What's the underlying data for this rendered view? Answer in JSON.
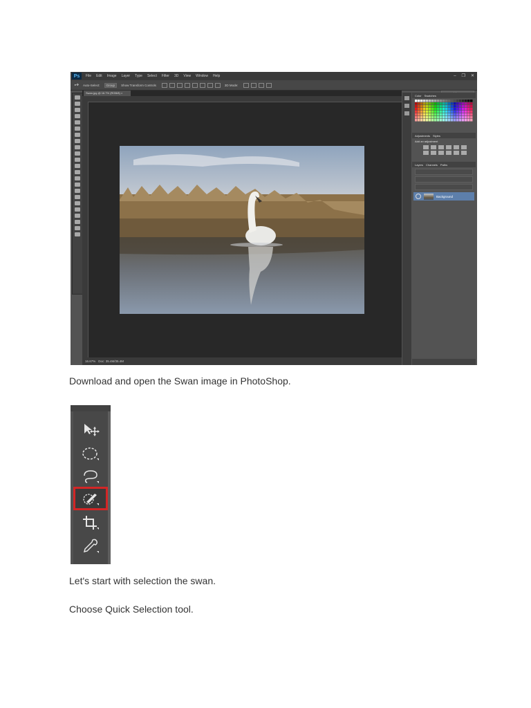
{
  "screenshot": {
    "menu": [
      "File",
      "Edit",
      "Image",
      "Layer",
      "Type",
      "Select",
      "Filter",
      "3D",
      "View",
      "Window",
      "Help"
    ],
    "window_controls": [
      "–",
      "❐",
      "✕"
    ],
    "options_bar": {
      "auto_select": "Auto-Select:",
      "auto_select_value": "Group",
      "show_transform": "Show Transform Controls",
      "mode_3d": "3D Mode:"
    },
    "workspace": "Essentials",
    "document_tab": "Swan.jpg @ 16.7% (RGB/8) ×",
    "status": {
      "zoom": "16.67%",
      "doc": "Doc: 35.4M/35.4M"
    },
    "panels": {
      "color_tabs": [
        "Color",
        "Swatches"
      ],
      "adjust_tabs": [
        "Adjustments",
        "Styles"
      ],
      "adjust_label": "Add an adjustment",
      "layers_tabs": [
        "Layers",
        "Channels",
        "Paths"
      ],
      "layer_name": "Background"
    }
  },
  "captions": {
    "step1": "Download and open the Swan image in PhotoShop.",
    "step2": "Let's start with selection the swan.",
    "step3": "Choose Quick Selection tool."
  },
  "tools": [
    "move-tool",
    "elliptical-marquee-tool",
    "lasso-tool",
    "quick-selection-tool",
    "crop-tool",
    "eyedropper-tool"
  ],
  "colors": {
    "highlight": "#d32626",
    "ui_dark": "#535353",
    "layer_selected": "#5d7fab"
  }
}
